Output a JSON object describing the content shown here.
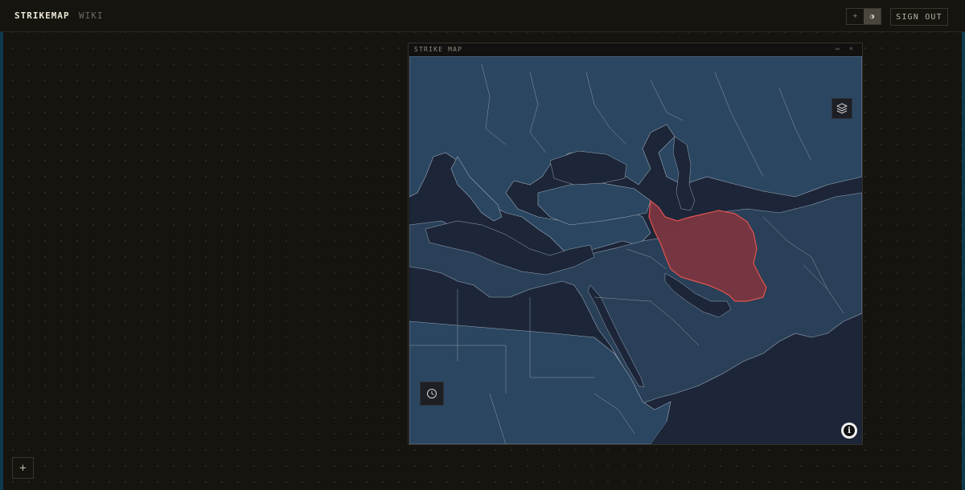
{
  "header": {
    "brand": "STRIKEMAP",
    "nav_wiki": "WIKI",
    "theme_light_glyph": "☀",
    "theme_dark_glyph": "◑",
    "sign_out": "SIGN OUT"
  },
  "panel": {
    "title": "STRIKE MAP",
    "min_glyph": "▭",
    "close_glyph": "×"
  },
  "map": {
    "highlighted_country": "Iran",
    "highlight_color": "#e0544f",
    "land_color": "#2b4660",
    "sea_color": "#1c2638",
    "border_color": "#9aa7b8",
    "controls": {
      "layers_icon": "layers-icon",
      "time_icon": "clock-icon",
      "info_glyph": "i"
    }
  },
  "footer": {
    "add_glyph": "+"
  }
}
